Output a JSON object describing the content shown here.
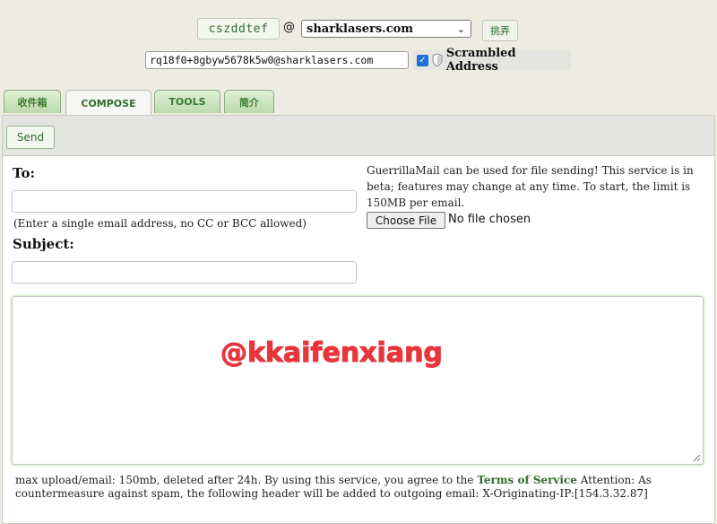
{
  "header": {
    "username": "cszddtef",
    "at_sign": "@",
    "domain_selected": "sharklasers.com",
    "set_button_label": "挑弄",
    "full_address": "rq18f0+8gbyw5678k5w0@sharklasers.com",
    "scrambled_checked": true,
    "scrambled_label": "Scrambled Address"
  },
  "tabs": [
    {
      "label": "收件箱",
      "active": false
    },
    {
      "label": "COMPOSE",
      "active": true
    },
    {
      "label": "TOOLS",
      "active": false
    },
    {
      "label": "简介",
      "active": false
    }
  ],
  "compose": {
    "send_label": "Send",
    "to_label": "To:",
    "to_value": "",
    "to_hint": "(Enter a single email address, no CC or BCC allowed)",
    "subject_label": "Subject:",
    "subject_value": "",
    "body_value": "",
    "file_info": "GuerrillaMail can be used for file sending! This service is in beta; features may change at any time. To start, the limit is 150MB per email.",
    "choose_file_label": "Choose File",
    "no_file_text": "No file chosen",
    "footer_text_1": "max upload/email: 150mb, deleted after 24h. By using this service, you agree to the ",
    "tos_link": "Terms of Service",
    "footer_text_2": " Attention: As countermeasure against spam, the following header will be added to outgoing email: X-Originating-IP:[154.3.32.87]"
  },
  "watermark": "@kkaifenxiang",
  "icons": {
    "dropdown": "chevron-down-icon",
    "scramble": "shield-icon",
    "resize": "resize-grip-icon"
  },
  "colors": {
    "accent_green": "#2f6d2b",
    "checkbox_blue": "#1f6fd6",
    "watermark_red": "#e8353b"
  }
}
